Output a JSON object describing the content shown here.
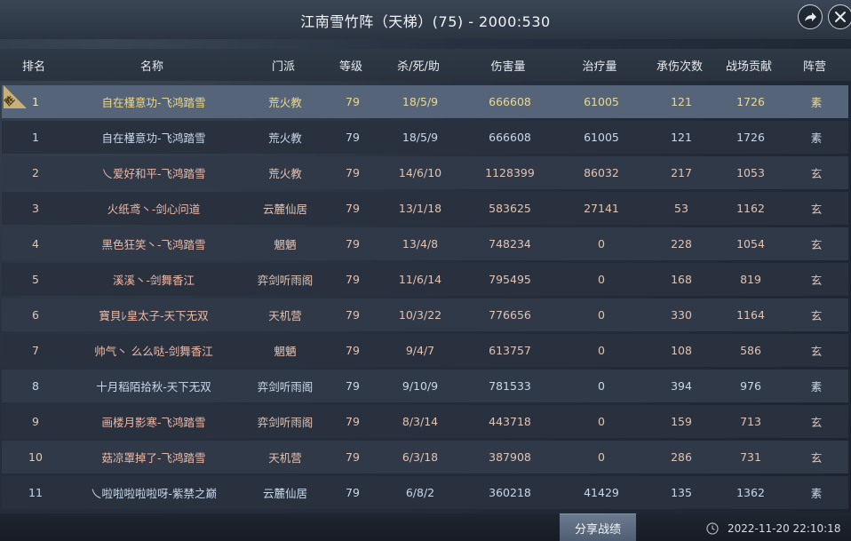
{
  "window": {
    "title": "江南雪竹阵（天梯）(75) - 2000:530"
  },
  "table": {
    "headers": {
      "rank": "排名",
      "name": "名称",
      "school": "门派",
      "level": "等级",
      "kda": "杀/死/助",
      "damage": "伤害量",
      "healing": "治疗量",
      "hits_taken": "承伤次数",
      "contribution": "战场贡献",
      "camp": "阵营"
    },
    "win_badge": "胜",
    "rows": [
      {
        "rank": "1",
        "name": "自在槿意功-飞鸿踏雪",
        "school": "荒火教",
        "level": "79",
        "kda": "18/5/9",
        "damage": "666608",
        "healing": "61005",
        "hits_taken": "121",
        "contribution": "1726",
        "camp": "素",
        "tone": "gold",
        "highlight": true,
        "badge": true
      },
      {
        "rank": "1",
        "name": "自在槿意功-飞鸿踏雪",
        "school": "荒火教",
        "level": "79",
        "kda": "18/5/9",
        "damage": "666608",
        "healing": "61005",
        "hits_taken": "121",
        "contribution": "1726",
        "camp": "素",
        "tone": "blue"
      },
      {
        "rank": "2",
        "name": "乀爱好和平-飞鸿踏雪",
        "school": "荒火教",
        "level": "79",
        "kda": "14/6/10",
        "damage": "1128399",
        "healing": "86032",
        "hits_taken": "217",
        "contribution": "1053",
        "camp": "玄",
        "tone": "red"
      },
      {
        "rank": "3",
        "name": "火纸鸢丶-剑心问道",
        "school": "云麓仙居",
        "level": "79",
        "kda": "13/1/18",
        "damage": "583625",
        "healing": "27141",
        "hits_taken": "53",
        "contribution": "1162",
        "camp": "玄",
        "tone": "red"
      },
      {
        "rank": "4",
        "name": "黑色狂笑丶-飞鸿踏雪",
        "school": "魍魉",
        "level": "79",
        "kda": "13/4/8",
        "damage": "748234",
        "healing": "0",
        "hits_taken": "228",
        "contribution": "1054",
        "camp": "玄",
        "tone": "red"
      },
      {
        "rank": "5",
        "name": "溪溪丶-剑舞香江",
        "school": "弈剑听雨阁",
        "level": "79",
        "kda": "11/6/14",
        "damage": "795495",
        "healing": "0",
        "hits_taken": "168",
        "contribution": "819",
        "camp": "玄",
        "tone": "red"
      },
      {
        "rank": "6",
        "name": "寶貝ﾚ皇太子-天下无双",
        "school": "天机营",
        "level": "79",
        "kda": "10/3/22",
        "damage": "776656",
        "healing": "0",
        "hits_taken": "330",
        "contribution": "1164",
        "camp": "玄",
        "tone": "red"
      },
      {
        "rank": "7",
        "name": "帅气丶 么么哒-剑舞香江",
        "school": "魍魉",
        "level": "79",
        "kda": "9/4/7",
        "damage": "613757",
        "healing": "0",
        "hits_taken": "108",
        "contribution": "586",
        "camp": "玄",
        "tone": "red"
      },
      {
        "rank": "8",
        "name": "十月稻陌拾秋-天下无双",
        "school": "弈剑听雨阁",
        "level": "79",
        "kda": "9/10/9",
        "damage": "781533",
        "healing": "0",
        "hits_taken": "394",
        "contribution": "976",
        "camp": "素",
        "tone": "blue"
      },
      {
        "rank": "9",
        "name": "画楼月影寒-飞鸿踏雪",
        "school": "弈剑听雨阁",
        "level": "79",
        "kda": "8/3/14",
        "damage": "443718",
        "healing": "0",
        "hits_taken": "159",
        "contribution": "713",
        "camp": "玄",
        "tone": "red"
      },
      {
        "rank": "10",
        "name": "菇凉罩掉了-飞鸿踏雪",
        "school": "天机营",
        "level": "79",
        "kda": "6/3/18",
        "damage": "387908",
        "healing": "0",
        "hits_taken": "286",
        "contribution": "731",
        "camp": "玄",
        "tone": "red"
      },
      {
        "rank": "11",
        "name": "乀啦啦啦啦啦呀-紫禁之巅",
        "school": "云麓仙居",
        "level": "79",
        "kda": "6/8/2",
        "damage": "360218",
        "healing": "41429",
        "hits_taken": "135",
        "contribution": "1362",
        "camp": "素",
        "tone": "blue"
      }
    ]
  },
  "footer": {
    "share_label": "分享战绩",
    "timestamp": "2022-11-20 22:10:18"
  },
  "icons": {
    "share": "share-arrow-icon",
    "close": "close-icon",
    "clock": "clock-icon"
  }
}
